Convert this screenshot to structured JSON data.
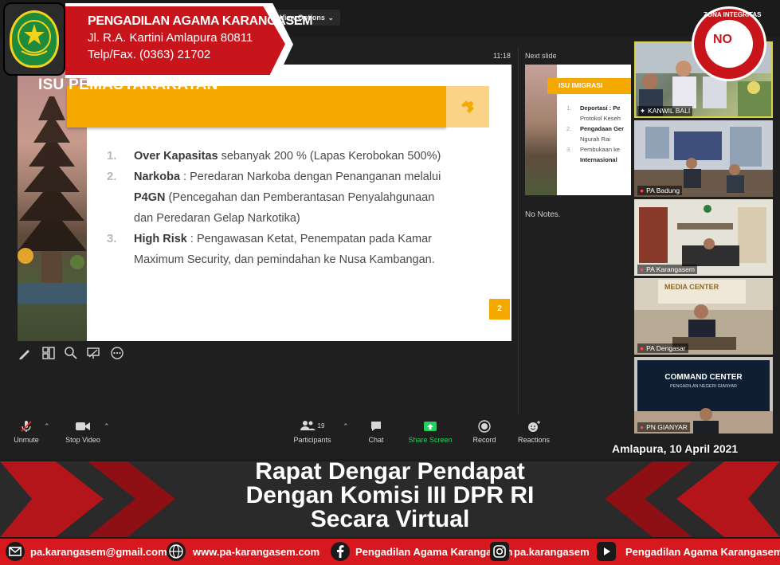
{
  "header": {
    "org_name": "PENGADILAN AGAMA KARANGASEM",
    "address": "Jl. R.A. Kartini Amlapura 80811",
    "phone": "Telp/Fax. (0363) 21702"
  },
  "badge": {
    "top_text": "ZONA INTEGRITAS",
    "center_text": "NO"
  },
  "zoom": {
    "view_options_label": "View Options",
    "slide_time": "11:18",
    "next_slide_label": "Next slide",
    "notes_text": "No Notes.",
    "toolbar": {
      "unmute": "Unmute",
      "stop_video": "Stop Video",
      "participants": "Participants",
      "participants_count": "19",
      "chat": "Chat",
      "share_screen": "Share Screen",
      "record": "Record",
      "reactions": "Reactions"
    }
  },
  "slide": {
    "title": "ISU PEMASYARAKATAN",
    "page_number": "2",
    "items": [
      {
        "num": "1.",
        "bold": "Over Kapasitas",
        "text": " sebanyak 200 % (Lapas Kerobokan 500%)"
      },
      {
        "num": "2.",
        "bold": "Narkoba",
        "text": " : Peredaran Narkoba dengan Penanganan melalui ",
        "bold2": "P4GN",
        "text2": " (Pencegahan dan Pemberantasan Penyalahgunaan dan Peredaran Gelap Narkotika)"
      },
      {
        "num": "3.",
        "bold": "High Risk",
        "text": " : Pengawasan Ketat, Penempatan pada Kamar Maximum Security, dan pemindahan ke Nusa Kambangan."
      }
    ]
  },
  "next_slide": {
    "title": "ISU IMIGRASI",
    "lines": [
      {
        "num": "1.",
        "text": "Deportasi : Pe"
      },
      {
        "num": "",
        "text": "Protokol Keseh"
      },
      {
        "num": "2.",
        "text": "Pengadaan Ger"
      },
      {
        "num": "",
        "text": "Ngurah Rai"
      },
      {
        "num": "3.",
        "text": "Pembukaan ke"
      },
      {
        "num": "",
        "text": "Internasional"
      }
    ]
  },
  "participants": [
    {
      "name": "KANWIL BALI",
      "muted": false,
      "pinned": true,
      "active": true
    },
    {
      "name": "PA Badung",
      "muted": true,
      "pinned": false,
      "active": false
    },
    {
      "name": "PA Karangasem",
      "muted": true,
      "pinned": false,
      "active": false
    },
    {
      "name": "PA Dengasar",
      "muted": true,
      "pinned": false,
      "active": false
    },
    {
      "name": "PN GIANYAR",
      "muted": true,
      "pinned": false,
      "active": false
    }
  ],
  "tile_signs": {
    "media_center": "MEDIA CENTER",
    "command_center": "COMMAND CENTER",
    "command_center_sub": "PENGADILAN NEGERI GIANYAR"
  },
  "date_caption": "Amlapura, 10 April 2021",
  "title_banner": {
    "line1": "Rapat Dengar Pendapat",
    "line2": "Dengan Komisi III DPR RI",
    "line3": "Secara Virtual"
  },
  "footer": {
    "email": "pa.karangasem@gmail.com",
    "website": "www.pa-karangasem.com",
    "facebook": "Pengadilan Agama Karangasem",
    "instagram": "pa.karangasem",
    "youtube": "Pengadilan Agama Karangasem"
  },
  "colors": {
    "slide_accent": "#f5a800",
    "header_red": "#c8151b",
    "footer_red": "#d7191f",
    "share_green": "#23d160"
  }
}
